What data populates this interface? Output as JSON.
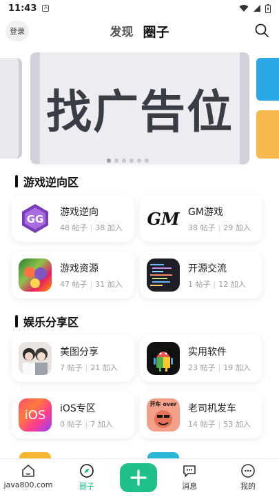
{
  "status_bar": {
    "time": "11:43",
    "notif": "A"
  },
  "header": {
    "login": "登录",
    "tabs": [
      {
        "label": "发现"
      },
      {
        "label": "圈子"
      }
    ]
  },
  "banner": {
    "text": "找广告位",
    "dots": 6,
    "active_dot": 0
  },
  "sections": [
    {
      "title": "游戏逆向区",
      "cards": [
        {
          "name": "游戏逆向",
          "posts": "48 帖子",
          "joins": "38 加入"
        },
        {
          "name": "GM游戏",
          "posts": "38 帖子",
          "joins": "29 加入",
          "logo_text": "GM"
        },
        {
          "name": "游戏资源",
          "posts": "47 帖子",
          "joins": "31 加入"
        },
        {
          "name": "开源交流",
          "posts": "1 帖子",
          "joins": "12 加入"
        }
      ]
    },
    {
      "title": "娱乐分享区",
      "cards": [
        {
          "name": "美图分享",
          "posts": "7 帖子",
          "joins": "21 加入"
        },
        {
          "name": "实用软件",
          "posts": "23 帖子",
          "joins": "19 加入"
        },
        {
          "name": "iOS专区",
          "posts": "0 帖子",
          "joins": "7 加入",
          "logo_text": "iOS"
        },
        {
          "name": "老司机发车",
          "posts": "14 帖子",
          "joins": "53 加入",
          "logo_text": "开车 over"
        }
      ]
    }
  ],
  "bottom_nav": {
    "items": [
      {
        "label": "java800.com"
      },
      {
        "label": "圈子"
      },
      {
        "label": "消息"
      },
      {
        "label": "我的"
      }
    ]
  },
  "colors": {
    "accent": "#1fc08a",
    "text": "#222222",
    "muted": "#9a9a9a"
  }
}
